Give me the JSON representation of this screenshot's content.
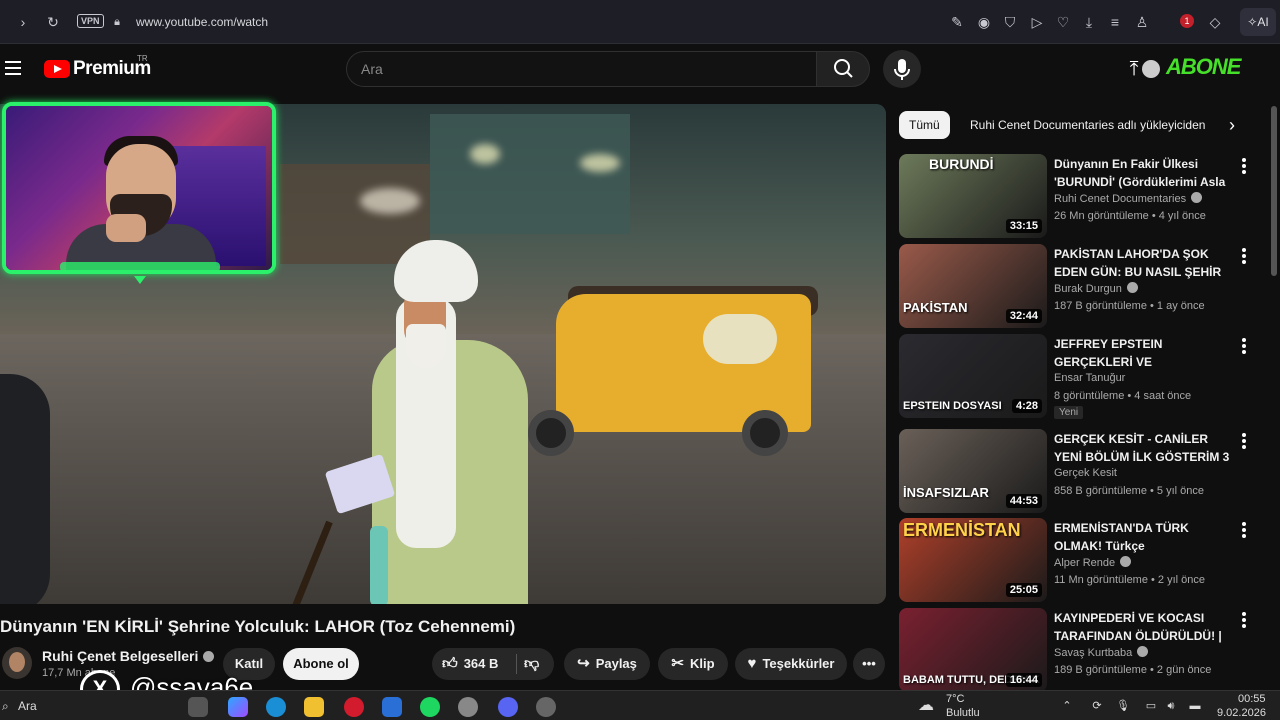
{
  "browser": {
    "url": "www.youtube.com/watch",
    "vpn_label": "VPN",
    "ai_label": "AI",
    "profile_badge": "1"
  },
  "header": {
    "logo": "Premium",
    "region": "TR",
    "search_placeholder": "Ara",
    "abone_overlay": "ABONE"
  },
  "video": {
    "title": "Dünyanın 'EN KİRLİ' Şehrine Yolculuk: LAHOR (Toz Cehennemi)",
    "channel": "Ruhi Çenet Belgeselleri",
    "subscribers": "17,7 Mn abone",
    "join_label": "Katıl",
    "subscribe_label": "Abone ol",
    "likes": "364 B",
    "share_label": "Paylaş",
    "clip_label": "Klip",
    "thanks_label": "Teşekkürler"
  },
  "watermark": {
    "x_letter": "X",
    "handle": "@ssava6e"
  },
  "chips": {
    "all": "Tümü",
    "next": "Ruhi Cenet Documentaries adlı yükleyiciden"
  },
  "recommendations": [
    {
      "title": "Dünyanın En Fakir Ülkesi 'BURUNDİ' (Gördüklerimi Asla ...",
      "channel": "Ruhi Cenet Documentaries",
      "verified": true,
      "meta": "26 Mn görüntüleme • 4 yıl önce",
      "duration": "33:15",
      "thumb_text": "BURUNDİ",
      "badge": "",
      "color": "#6d7a5a"
    },
    {
      "title": "PAKİSTAN LAHOR'DA ŞOK EDEN GÜN: BU NASIL ŞEHİR",
      "flag": "PK",
      "channel": "Burak Durgun",
      "verified": true,
      "meta": "187 B görüntüleme • 1 ay önce",
      "duration": "32:44",
      "thumb_text": "PAKİSTAN",
      "badge": "",
      "color": "#9a5a4a"
    },
    {
      "title": "JEFFREY EPSTEIN GERÇEKLERİ VE BİLİNMEYENLER!!!",
      "channel": "Ensar Tanuğur",
      "verified": false,
      "meta": "8 görüntüleme • 4 saat önce",
      "duration": "4:28",
      "thumb_text": "EPSTEIN DOSYASI",
      "badge": "Yeni",
      "color": "#2a2a30"
    },
    {
      "title": "GERÇEK KESİT - CANİLER  YENİ BÖLÜM  İLK GÖSTERİM 3 ...",
      "channel": "Gerçek Kesit",
      "verified": false,
      "meta": "858 B görüntüleme • 5 yıl önce",
      "duration": "44:53",
      "thumb_text": "İNSAFSIZLAR",
      "badge": "",
      "color": "#6a6058"
    },
    {
      "title": "ERMENİSTAN'DA TÜRK OLMAK! Türkçe konuştuğumuzu duyan ...",
      "channel": "Alper Rende",
      "verified": true,
      "meta": "11 Mn görüntüleme • 2 yıl önce",
      "duration": "25:05",
      "thumb_text": "ERMENİSTAN",
      "badge": "",
      "color": "#b0402a"
    },
    {
      "title": "KAYINPEDERİ VE KOCASI TARAFINDAN ÖLDÜRÜLDÜ! | ...",
      "channel": "Savaş Kurtbaba",
      "verified": true,
      "meta": "189 B görüntüleme • 2 gün önce",
      "duration": "16:44",
      "thumb_text": "BABAM TUTTU, DEDEM K",
      "badge": "",
      "color": "#7a2030"
    }
  ],
  "taskbar": {
    "search": "Ara",
    "temperature": "7°C",
    "weather": "Bulutlu",
    "time": "00:55",
    "date": "9.02.2026"
  }
}
